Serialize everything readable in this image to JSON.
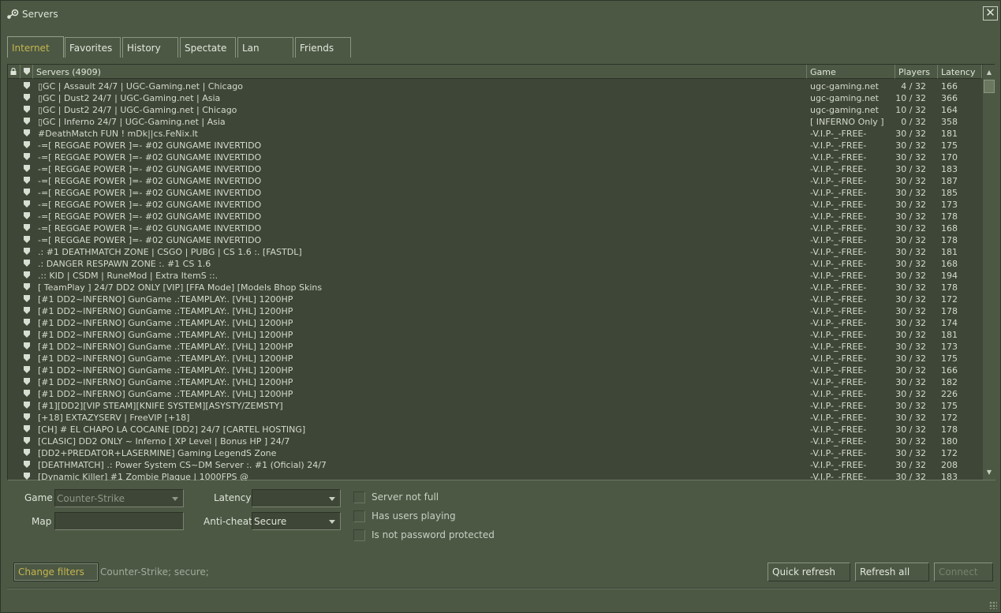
{
  "window": {
    "title": "Servers"
  },
  "tabs": [
    {
      "label": "Internet",
      "active": true
    },
    {
      "label": "Favorites",
      "active": false
    },
    {
      "label": "History",
      "active": false
    },
    {
      "label": "Spectate",
      "active": false
    },
    {
      "label": "Lan",
      "active": false
    },
    {
      "label": "Friends",
      "active": false
    }
  ],
  "list": {
    "columns": {
      "servers": "Servers (4909)",
      "game": "Game",
      "players": "Players",
      "latency": "Latency"
    },
    "rows": [
      {
        "name": "▯GC | Assault 24/7 | UGC-Gaming.net | Chicago",
        "game": "ugc-gaming.net",
        "players": "4 / 32",
        "latency": "166"
      },
      {
        "name": "▯GC | Dust2 24/7 | UGC-Gaming.net | Asia",
        "game": "ugc-gaming.net",
        "players": "10 / 32",
        "latency": "366"
      },
      {
        "name": "▯GC | Dust2 24/7 | UGC-Gaming.net | Chicago",
        "game": "ugc-gaming.net",
        "players": "10 / 32",
        "latency": "164"
      },
      {
        "name": "▯GC | Inferno 24/7 | UGC-Gaming.net | Asia",
        "game": "[ INFERNO Only ]",
        "players": "0 / 32",
        "latency": "358"
      },
      {
        "name": "#DeathMatch FUN ! mDk||cs.FeNix.lt",
        "game": "-V.I.P-_-FREE-",
        "players": "30 / 32",
        "latency": "181"
      },
      {
        "name": "-=[ REGGAE POWER ]=- #02 GUNGAME INVERTIDO",
        "game": "-V.I.P-_-FREE-",
        "players": "30 / 32",
        "latency": "175"
      },
      {
        "name": "-=[ REGGAE POWER ]=- #02 GUNGAME INVERTIDO",
        "game": "-V.I.P-_-FREE-",
        "players": "30 / 32",
        "latency": "170"
      },
      {
        "name": "-=[ REGGAE POWER ]=- #02 GUNGAME INVERTIDO",
        "game": "-V.I.P-_-FREE-",
        "players": "30 / 32",
        "latency": "183"
      },
      {
        "name": "-=[ REGGAE POWER ]=- #02 GUNGAME INVERTIDO",
        "game": "-V.I.P-_-FREE-",
        "players": "30 / 32",
        "latency": "187"
      },
      {
        "name": "-=[ REGGAE POWER ]=- #02 GUNGAME INVERTIDO",
        "game": "-V.I.P-_-FREE-",
        "players": "30 / 32",
        "latency": "185"
      },
      {
        "name": "-=[ REGGAE POWER ]=- #02 GUNGAME INVERTIDO",
        "game": "-V.I.P-_-FREE-",
        "players": "30 / 32",
        "latency": "173"
      },
      {
        "name": "-=[ REGGAE POWER ]=- #02 GUNGAME INVERTIDO",
        "game": "-V.I.P-_-FREE-",
        "players": "30 / 32",
        "latency": "178"
      },
      {
        "name": "-=[ REGGAE POWER ]=- #02 GUNGAME INVERTIDO",
        "game": "-V.I.P-_-FREE-",
        "players": "30 / 32",
        "latency": "168"
      },
      {
        "name": "-=[ REGGAE POWER ]=- #02 GUNGAME INVERTIDO",
        "game": "-V.I.P-_-FREE-",
        "players": "30 / 32",
        "latency": "178"
      },
      {
        "name": ".: #1 DEATHMATCH ZONE | CSGO | PUBG | CS 1.6 :. [FASTDL]",
        "game": "-V.I.P-_-FREE-",
        "players": "30 / 32",
        "latency": "181"
      },
      {
        "name": ".: DANGER RESPAWN ZONE :. #1 CS 1.6",
        "game": "-V.I.P-_-FREE-",
        "players": "30 / 32",
        "latency": "168"
      },
      {
        "name": ".:: KID | CSDM | RuneMod | Extra ItemS ::.",
        "game": "-V.I.P-_-FREE-",
        "players": "30 / 32",
        "latency": "194"
      },
      {
        "name": "[ TeamPlay ] 24/7 DD2 ONLY [VIP] [FFA Mode] [Models Bhop Skins",
        "game": "-V.I.P-_-FREE-",
        "players": "30 / 32",
        "latency": "178"
      },
      {
        "name": "[#1 DD2~INFERNO] GunGame .:TEAMPLAY:. [VHL] 1200HP",
        "game": "-V.I.P-_-FREE-",
        "players": "30 / 32",
        "latency": "172"
      },
      {
        "name": "[#1 DD2~INFERNO] GunGame .:TEAMPLAY:. [VHL] 1200HP",
        "game": "-V.I.P-_-FREE-",
        "players": "30 / 32",
        "latency": "178"
      },
      {
        "name": "[#1 DD2~INFERNO] GunGame .:TEAMPLAY:. [VHL] 1200HP",
        "game": "-V.I.P-_-FREE-",
        "players": "30 / 32",
        "latency": "174"
      },
      {
        "name": "[#1 DD2~INFERNO] GunGame .:TEAMPLAY:. [VHL] 1200HP",
        "game": "-V.I.P-_-FREE-",
        "players": "30 / 32",
        "latency": "181"
      },
      {
        "name": "[#1 DD2~INFERNO] GunGame .:TEAMPLAY:. [VHL] 1200HP",
        "game": "-V.I.P-_-FREE-",
        "players": "30 / 32",
        "latency": "173"
      },
      {
        "name": "[#1 DD2~INFERNO] GunGame .:TEAMPLAY:. [VHL] 1200HP",
        "game": "-V.I.P-_-FREE-",
        "players": "30 / 32",
        "latency": "175"
      },
      {
        "name": "[#1 DD2~INFERNO] GunGame .:TEAMPLAY:. [VHL] 1200HP",
        "game": "-V.I.P-_-FREE-",
        "players": "30 / 32",
        "latency": "166"
      },
      {
        "name": "[#1 DD2~INFERNO] GunGame .:TEAMPLAY:. [VHL] 1200HP",
        "game": "-V.I.P-_-FREE-",
        "players": "30 / 32",
        "latency": "182"
      },
      {
        "name": "[#1 DD2~INFERNO] GunGame .:TEAMPLAY:. [VHL] 1200HP",
        "game": "-V.I.P-_-FREE-",
        "players": "30 / 32",
        "latency": "226"
      },
      {
        "name": "[#1][DD2][VIP STEAM][KNIFE SYSTEM][ASYSTY/ZEMSTY]",
        "game": "-V.I.P-_-FREE-",
        "players": "30 / 32",
        "latency": "175"
      },
      {
        "name": "[+18] EXTAZYSERV | FreeVIP [+18]",
        "game": "-V.I.P-_-FREE-",
        "players": "30 / 32",
        "latency": "172"
      },
      {
        "name": "[CH] # EL CHAPO LA COCAINE [DD2] 24/7 [CARTEL HOSTING]",
        "game": "-V.I.P-_-FREE-",
        "players": "30 / 32",
        "latency": "178"
      },
      {
        "name": "[CLASIC] DD2 ONLY ~ Inferno [ XP Level | Bonus HP ] 24/7",
        "game": "-V.I.P-_-FREE-",
        "players": "30 / 32",
        "latency": "180"
      },
      {
        "name": "[DD2+PREDATOR+LASERMINE] Gaming LegendS Zone",
        "game": "-V.I.P-_-FREE-",
        "players": "30 / 32",
        "latency": "172"
      },
      {
        "name": "[DEATHMATCH] .: Power System CS~DM Server :. #1 (Oficial) 24/7",
        "game": "-V.I.P-_-FREE-",
        "players": "30 / 32",
        "latency": "208"
      },
      {
        "name": "[Dynamic Killer] #1 Zombie Plague | 1000FPS @",
        "game": "-V.I.P-_-FREE-",
        "players": "30 / 32",
        "latency": "183"
      }
    ]
  },
  "filters": {
    "game_label": "Game",
    "game_value": "Counter-Strike",
    "map_label": "Map",
    "map_value": "",
    "latency_label": "Latency",
    "latency_value": "",
    "anticheat_label": "Anti-cheat",
    "anticheat_value": "Secure",
    "server_not_full": "Server not full",
    "has_users_playing": "Has users playing",
    "not_password_protected": "Is not password protected"
  },
  "footer": {
    "change_filters": "Change filters",
    "summary": "Counter-Strike; secure;",
    "quick_refresh": "Quick refresh",
    "refresh_all": "Refresh all",
    "connect": "Connect"
  },
  "colors": {
    "background": "#4c5844",
    "list_background": "#3e4637",
    "accent": "#c4b550"
  }
}
